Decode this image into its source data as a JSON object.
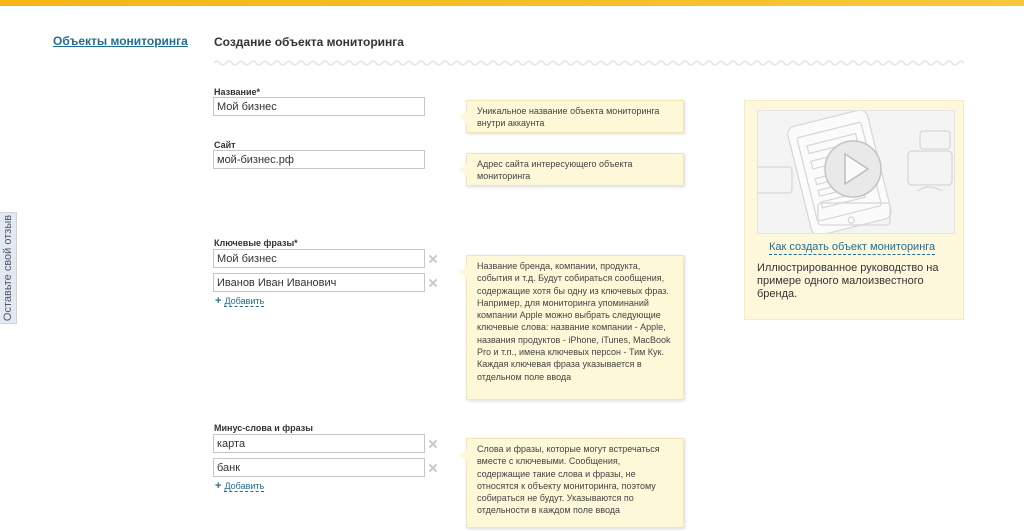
{
  "feedback": {
    "label": "Оставьте свой отзыв"
  },
  "sidebar": {
    "link": "Объекты мониторинга"
  },
  "page": {
    "title": "Создание объекта мониторинга"
  },
  "form": {
    "name": {
      "label": "Название*",
      "value": "Мой бизнес",
      "hint": "Уникальное название объекта мониторинга внутри аккаунта"
    },
    "site": {
      "label": "Сайт",
      "value": "мой-бизнес.рф",
      "hint": "Адрес сайта интересующего объекта мониторинга"
    },
    "keywords": {
      "label": "Ключевые фразы*",
      "values": [
        "Мой бизнес",
        "Иванов Иван Иванович"
      ],
      "add": "Добавить",
      "hint": "Название бренда, компании, продукта, события и т.д. Будут собираться сообщения, содержащие хотя бы одну из ключевых фраз. Например, для мониторинга упоминаний компании Apple можно выбрать следующие ключевые слова: название компании - Apple, названия продуктов - iPhone, iTunes, MacBook Pro и т.п., имена ключевых персон - Тим Кук.",
      "hint2": "Каждая ключевая фраза указывается в отдельном поле ввода"
    },
    "minus": {
      "label": "Минус-слова и фразы",
      "values": [
        "карта",
        "банк"
      ],
      "add": "Добавить",
      "hint": "Слова и фразы, которые могут встречаться вместе с ключевыми. Сообщения, содержащие такие слова и фразы, не относятся к объекту мониторинга, поэтому собираться не будут. Указываются по отдельности в каждом поле ввода"
    }
  },
  "video": {
    "link": "Как создать объект мониторинга",
    "description": "Иллюстрированное руководство на примере одного малоизвестного бренда.",
    "icon": "play-icon"
  },
  "colors": {
    "accent": "#f5b514",
    "link": "#1f6e96",
    "hint_bg": "#fdf8d8"
  }
}
